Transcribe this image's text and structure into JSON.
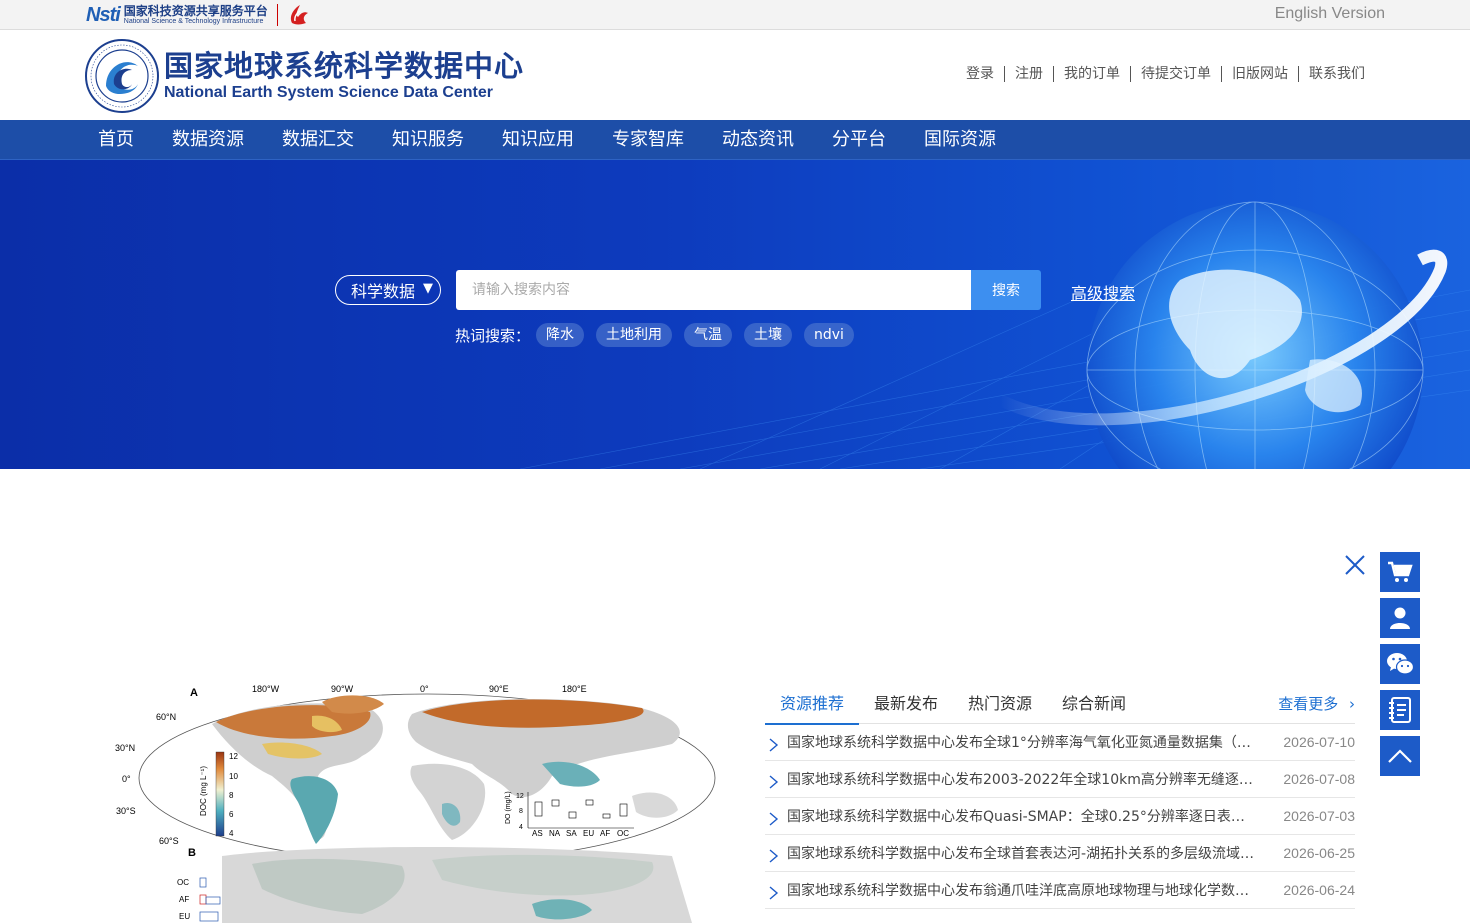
{
  "topbar": {
    "nsti_mark": "Nsti",
    "nsti_cn": "国家科技资源共享服务平台",
    "nsti_en": "National Science & Technology Infrastructure",
    "english_version": "English Version"
  },
  "header": {
    "brand_cn": "国家地球系统科学数据中心",
    "brand_en": "National Earth System Science Data Center",
    "user_links": [
      "登录",
      "注册",
      "我的订单",
      "待提交订单",
      "旧版网站",
      "联系我们"
    ]
  },
  "nav": {
    "items": [
      "首页",
      "数据资源",
      "数据汇交",
      "知识服务",
      "知识应用",
      "专家智库",
      "动态资讯",
      "分平台",
      "国际资源"
    ]
  },
  "search": {
    "type_label": "科学数据",
    "placeholder": "请输入搜索内容",
    "button": "搜索",
    "advanced": "高级搜索",
    "hot_label": "热词搜索：",
    "hot_tags": [
      "降水",
      "土地利用",
      "气温",
      "土壤",
      "ndvi"
    ]
  },
  "floatbar": {
    "icons": [
      "cart-icon",
      "user-icon",
      "wechat-icon",
      "manual-icon",
      "back-to-top-icon"
    ]
  },
  "figure": {
    "panel_a": "A",
    "panel_b": "B",
    "lon_labels": [
      "180°W",
      "90°W",
      "0°",
      "90°E",
      "180°E"
    ],
    "lat_labels": [
      "60°N",
      "30°N",
      "0°",
      "30°S",
      "60°S"
    ],
    "colorbar_label": "DOC (mg L⁻¹)",
    "colorbar_ticks": [
      "12",
      "10",
      "8",
      "6",
      "4"
    ],
    "inset_ylabel": "DO (mg/L)",
    "inset_yticks": [
      "12",
      "8",
      "4"
    ],
    "inset_categories": [
      "AS",
      "NA",
      "SA",
      "EU",
      "AF",
      "OC"
    ],
    "panel_b_categories": [
      "OC",
      "AF",
      "EU"
    ]
  },
  "news": {
    "tabs": [
      "资源推荐",
      "最新发布",
      "热门资源",
      "综合新闻"
    ],
    "more": "查看更多",
    "items": [
      {
        "title": "国家地球系统科学数据中心发布全球1°分辨率海气氧化亚氮通量数据集（…",
        "date": "2026-07-10"
      },
      {
        "title": "国家地球系统科学数据中心发布2003-2022年全球10km高分辨率无缝逐日…",
        "date": "2026-07-08"
      },
      {
        "title": "国家地球系统科学数据中心发布Quasi-SMAP：全球0.25°分辨率逐日表层…",
        "date": "2026-07-03"
      },
      {
        "title": "国家地球系统科学数据中心发布全球首套表达河-湖拓扑关系的多层级流域…",
        "date": "2026-06-25"
      },
      {
        "title": "国家地球系统科学数据中心发布翁通爪哇洋底高原地球物理与地球化学数…",
        "date": "2026-06-24"
      }
    ]
  },
  "colors": {
    "nav_blue": "#1d4ea8",
    "banner_blue": "#0d3bbd",
    "accent": "#1d6fd1",
    "float_btn": "#1d5bc8"
  }
}
